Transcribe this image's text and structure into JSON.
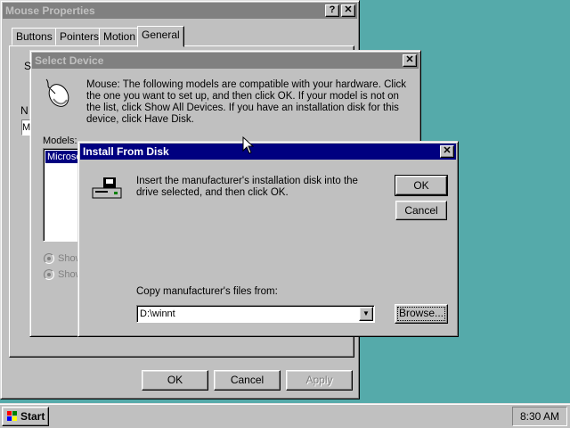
{
  "mouse_properties": {
    "title": "Mouse Properties",
    "tabs": [
      "Buttons",
      "Pointers",
      "Motion",
      "General"
    ],
    "active_tab": "General",
    "ok_label": "OK",
    "cancel_label": "Cancel",
    "apply_label": "Apply"
  },
  "select_device": {
    "title": "Select Device",
    "description": "Mouse: The following models are compatible with your hardware. Click the one you want to set up, and then click OK. If your model is not on the list, click Show All Devices. If you have an installation disk for this device, click Have Disk.",
    "models_label": "Models:",
    "selected_model": "Microso",
    "radio_1": "Show",
    "radio_2": "Show"
  },
  "install_from_disk": {
    "title": "Install From Disk",
    "message": "Insert the manufacturer's installation disk into the drive selected, and then click OK.",
    "ok_label": "OK",
    "cancel_label": "Cancel",
    "copy_label": "Copy manufacturer's files from:",
    "path_value": "D:\\winnt",
    "browse_label": "Browse..."
  },
  "taskbar": {
    "start_label": "Start",
    "clock": "8:30 AM"
  },
  "colors": {
    "desktop": "#55aaaa",
    "active_title": "#000080",
    "inactive_title": "#808080",
    "face": "#c0c0c0"
  }
}
